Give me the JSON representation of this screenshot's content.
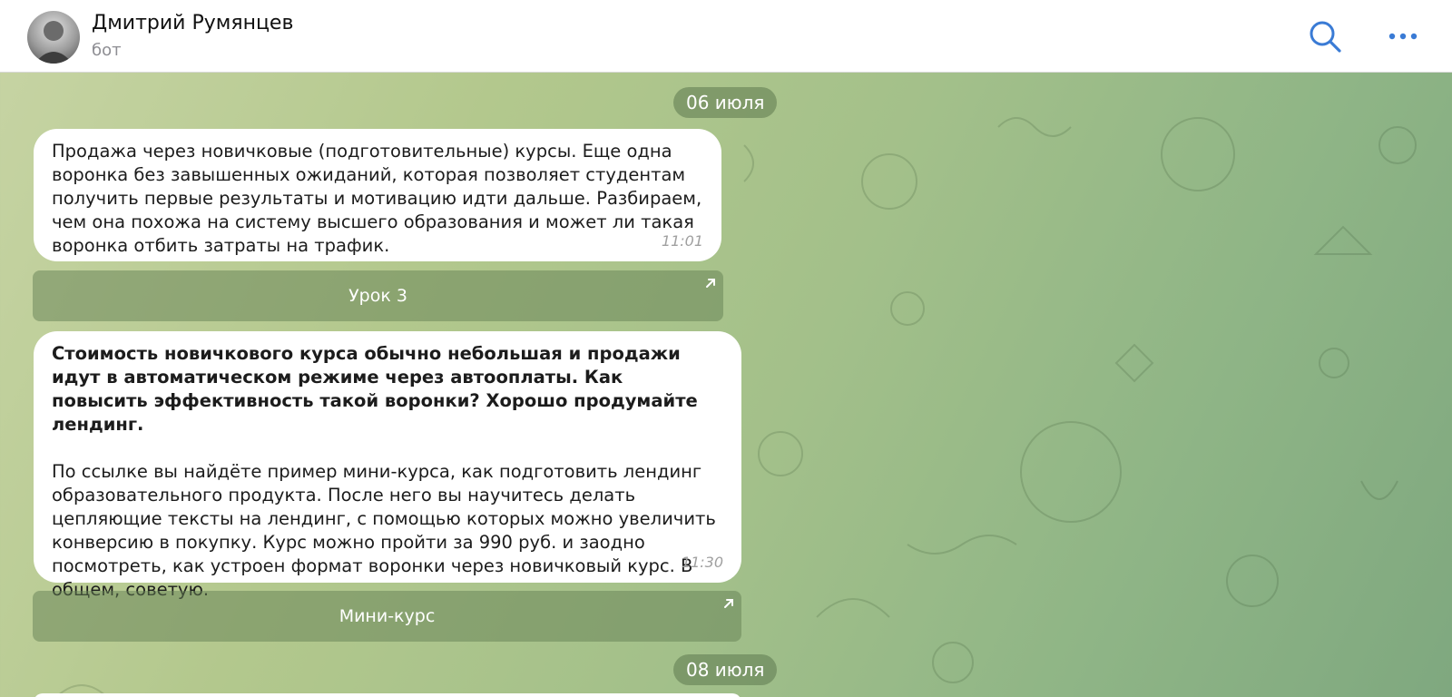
{
  "header": {
    "name": "Дмитрий Румянцев",
    "status": "бот",
    "search_icon": "search-icon",
    "more_icon": "more-icon"
  },
  "dates": {
    "first": "06 июля",
    "second": "08 июля"
  },
  "messages": [
    {
      "text": "Продажа через новичковые (подготовительные) курсы. Еще одна воронка без завышенных ожиданий, которая позволяет студентам получить первые результаты и мотивацию идти дальше. Разбираем, чем она похожа на систему высшего образования и может ли такая воронка отбить затраты на трафик.",
      "time": "11:01",
      "button": "Урок 3"
    },
    {
      "bold": "Стоимость новичкового курса обычно небольшая и продажи идут в автоматическом режиме через автооплаты. Как повысить эффективность такой воронки? Хорошо продумайте лендинг.",
      "text": "По ссылке вы найдёте пример мини-курса, как подготовить лендинг образовательного продукта. После него вы научитесь делать цепляющие тексты на лендинг, с помощью которых можно увеличить конверсию в покупку. Курс можно пройти за 990 руб. и заодно посмотреть, как устроен формат воронки через новичковый курс. В общем, советую.",
      "time": "11:30",
      "button": "Мини-курс"
    }
  ],
  "colors": {
    "accent": "#3a7bd5",
    "bubble": "#ffffff",
    "pill": "#6a8a5c"
  }
}
